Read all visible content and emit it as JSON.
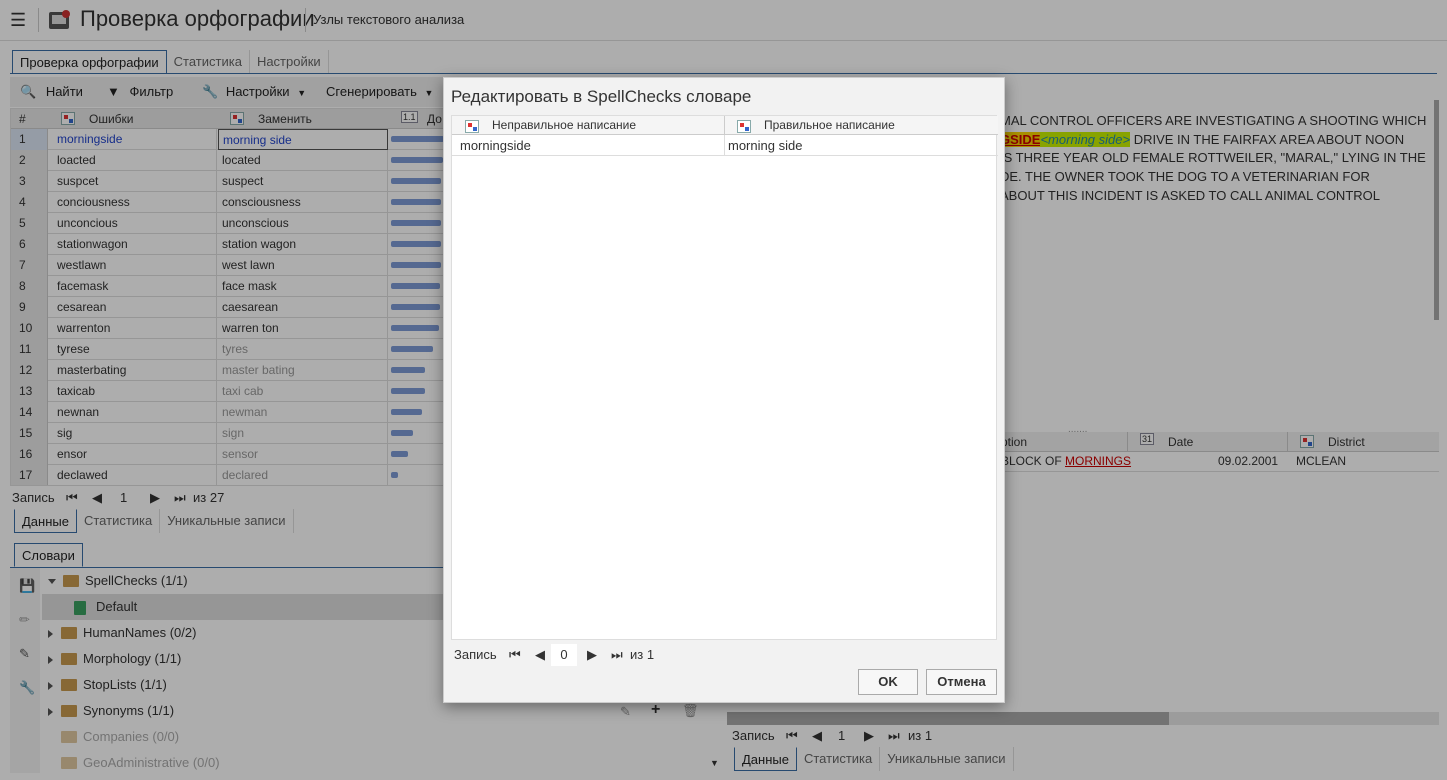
{
  "header": {
    "title": "Проверка орфографии",
    "subtitle": "Узлы текстового анализа"
  },
  "top_tabs": [
    "Проверка орфографии",
    "Статистика",
    "Настройки"
  ],
  "toolbar": {
    "find": "Найти",
    "filter": "Фильтр",
    "settings": "Настройки",
    "generate": "Сгенерировать"
  },
  "grid": {
    "headers": {
      "num": "#",
      "errors": "Ошибки",
      "replace": "Заменить",
      "extra": "До"
    },
    "rows": [
      {
        "n": "1",
        "err": "morningside",
        "rep": "morning side",
        "pct": 0.95,
        "dim": false,
        "sel": true
      },
      {
        "n": "2",
        "err": "loacted",
        "rep": "located",
        "pct": 0.92,
        "dim": false,
        "sel": false
      },
      {
        "n": "3",
        "err": "suspcet",
        "rep": "suspect",
        "pct": 0.9,
        "dim": false,
        "sel": false
      },
      {
        "n": "4",
        "err": "conciousness",
        "rep": "consciousness",
        "pct": 0.9,
        "dim": false,
        "sel": false
      },
      {
        "n": "5",
        "err": "unconcious",
        "rep": "unconscious",
        "pct": 0.9,
        "dim": false,
        "sel": false
      },
      {
        "n": "6",
        "err": "stationwagon",
        "rep": "station wagon",
        "pct": 0.9,
        "dim": false,
        "sel": false
      },
      {
        "n": "7",
        "err": "westlawn",
        "rep": "west lawn",
        "pct": 0.9,
        "dim": false,
        "sel": false
      },
      {
        "n": "8",
        "err": "facemask",
        "rep": "face mask",
        "pct": 0.88,
        "dim": false,
        "sel": false
      },
      {
        "n": "9",
        "err": "cesarean",
        "rep": "caesarean",
        "pct": 0.88,
        "dim": false,
        "sel": false
      },
      {
        "n": "10",
        "err": "warrenton",
        "rep": "warren ton",
        "pct": 0.86,
        "dim": false,
        "sel": false
      },
      {
        "n": "11",
        "err": "tyrese",
        "rep": "tyres",
        "pct": 0.75,
        "dim": true,
        "sel": false
      },
      {
        "n": "12",
        "err": "masterbating",
        "rep": "master bating",
        "pct": 0.6,
        "dim": true,
        "sel": false
      },
      {
        "n": "13",
        "err": "taxicab",
        "rep": "taxi cab",
        "pct": 0.6,
        "dim": true,
        "sel": false
      },
      {
        "n": "14",
        "err": "newnan",
        "rep": "newman",
        "pct": 0.55,
        "dim": true,
        "sel": false
      },
      {
        "n": "15",
        "err": "sig",
        "rep": "sign",
        "pct": 0.4,
        "dim": true,
        "sel": false
      },
      {
        "n": "16",
        "err": "ensor",
        "rep": "sensor",
        "pct": 0.3,
        "dim": true,
        "sel": false
      },
      {
        "n": "17",
        "err": "declawed",
        "rep": "declared",
        "pct": 0.12,
        "dim": true,
        "sel": false
      }
    ]
  },
  "pager_left": {
    "label": "Запись",
    "current": "1",
    "total": "из 27"
  },
  "bottom_tabs_left": [
    "Данные",
    "Статистика",
    "Уникальные записи"
  ],
  "dict_panel": {
    "tab": "Словари",
    "items": [
      {
        "label": "SpellChecks (1/1)",
        "expanded": true,
        "disabled": false,
        "level": 0
      },
      {
        "label": "Default",
        "expanded": false,
        "disabled": false,
        "level": 1
      },
      {
        "label": "HumanNames (0/2)",
        "expanded": false,
        "disabled": false,
        "level": 0
      },
      {
        "label": "Morphology (1/1)",
        "expanded": false,
        "disabled": false,
        "level": 0
      },
      {
        "label": "StopLists (1/1)",
        "expanded": false,
        "disabled": false,
        "level": 0
      },
      {
        "label": "Synonyms (1/1)",
        "expanded": false,
        "disabled": false,
        "level": 0
      },
      {
        "label": "Companies (0/0)",
        "expanded": false,
        "disabled": true,
        "level": 0
      },
      {
        "label": "GeoAdministrative (0/0)",
        "expanded": false,
        "disabled": true,
        "level": 0
      }
    ]
  },
  "right_text": {
    "line1": "MAL CONTROL OFFICERS ARE INVESTIGATING A SHOOTING WHICH",
    "hl_word": "GSIDE",
    "hl_repl": "<morning side>",
    "line2_rest": " DRIVE IN THE FAIRFAX AREA ABOUT NOON",
    "line3": "IS THREE YEAR OLD FEMALE ROTTWEILER, \"MARAL,\" LYING IN THE",
    "line4": "DE. THE OWNER TOOK THE DOG TO A VETERINARIAN FOR",
    "line5": "ABOUT THIS INCIDENT IS ASKED TO CALL ANIMAL CONTROL"
  },
  "right_grid": {
    "col1": "ption",
    "col2": "Date",
    "col3": "District",
    "row_desc_prefix": "BLOCK OF ",
    "row_desc_link": "MORNINGS",
    "row_date": "09.02.2001",
    "row_district": "MCLEAN"
  },
  "pager_right": {
    "label": "Запись",
    "current": "1",
    "total": "из 1"
  },
  "bottom_tabs_right": [
    "Данные",
    "Статистика",
    "Уникальные записи"
  ],
  "dialog": {
    "title": "Редактировать в SpellChecks словаре",
    "col_wrong": "Неправильное написание",
    "col_right": "Правильное написание",
    "row_wrong": "morningside",
    "row_right": "morning side",
    "pager_label": "Запись",
    "pager_current": "0",
    "pager_total": "из 1",
    "ok": "OK",
    "cancel": "Отмена"
  },
  "colors": {
    "accent": "#3a6ea5",
    "bar": "#7e9bd6",
    "overlay": "rgba(0,0,0,0.32)"
  }
}
